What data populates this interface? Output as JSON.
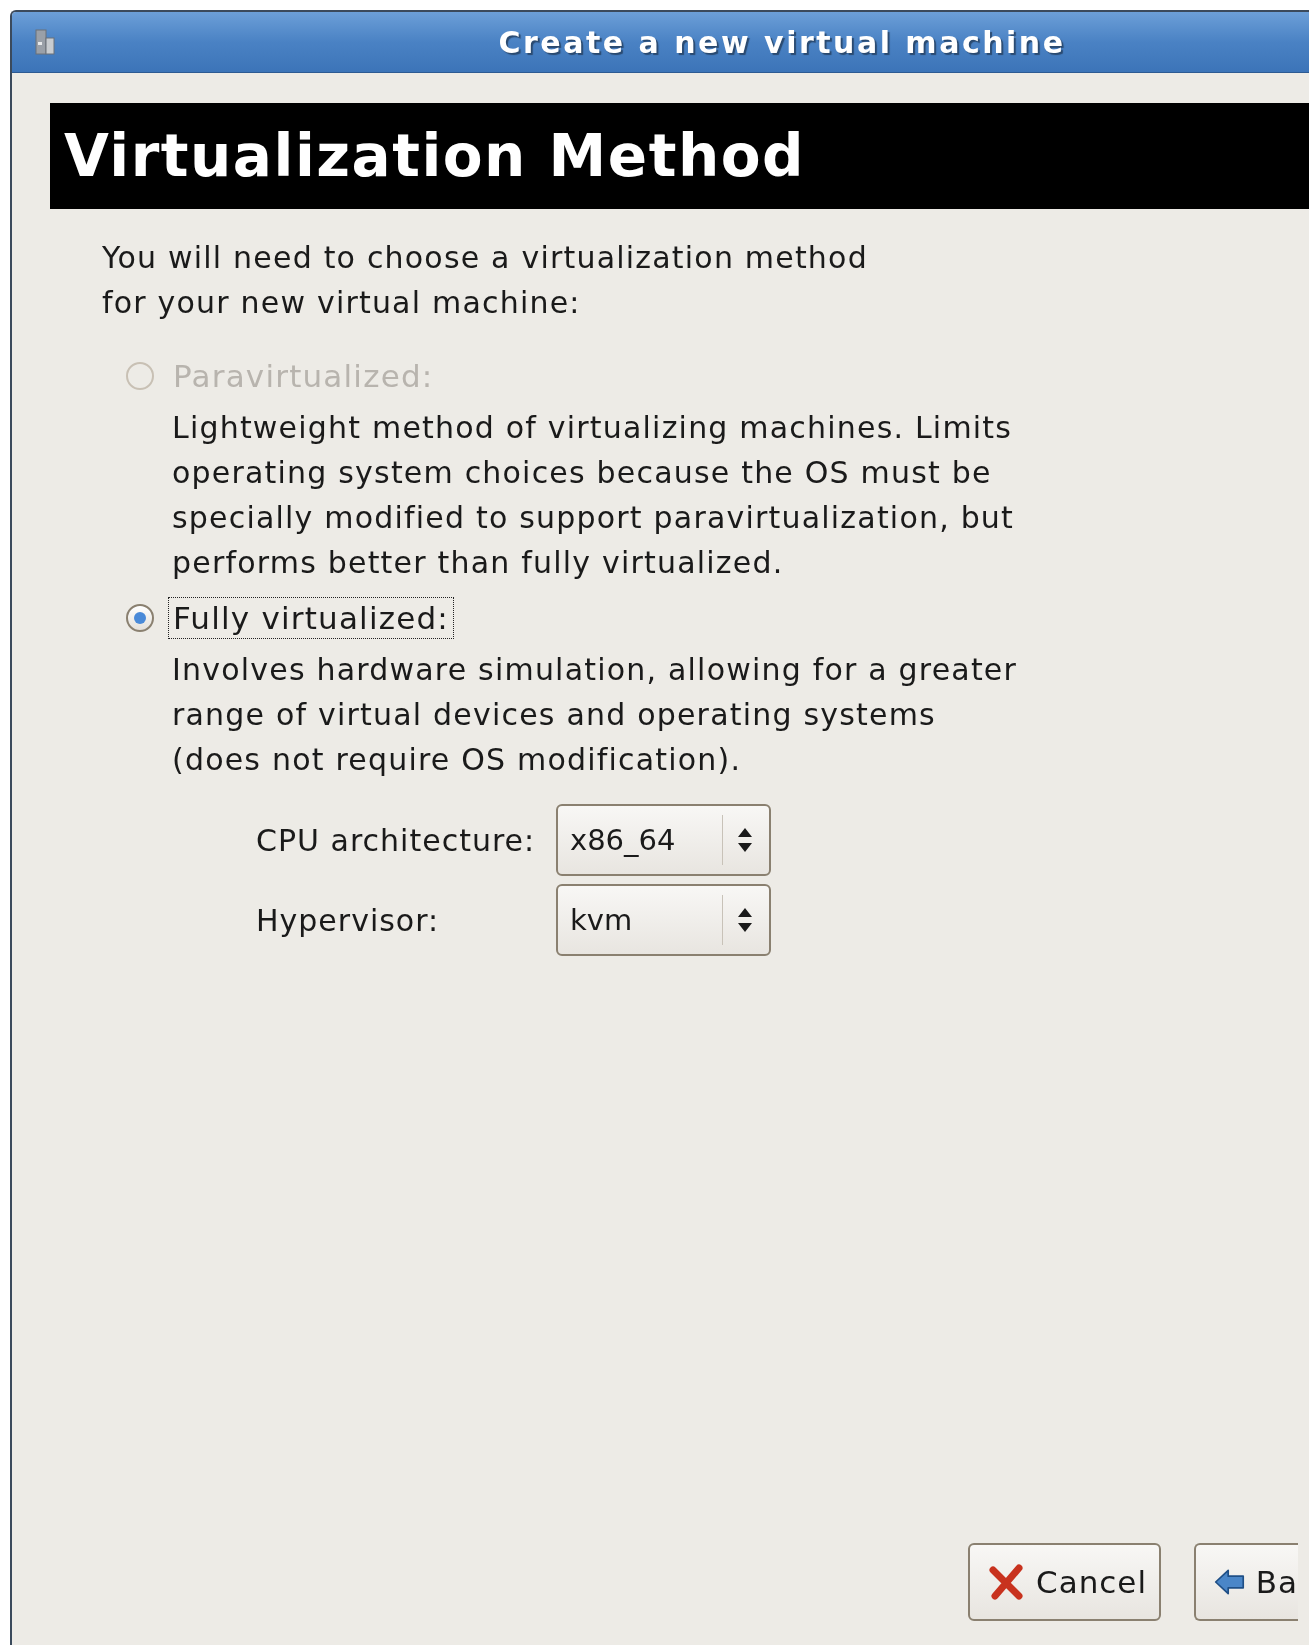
{
  "window": {
    "title": "Create a new virtual machine"
  },
  "heading": "Virtualization Method",
  "intro": "You will need to choose a virtualization method\nfor your new virtual machine:",
  "options": [
    {
      "label": "Paravirtualized:",
      "selected": false,
      "disabled": true,
      "focused": false,
      "description": "Lightweight method of virtualizing machines. Limits\noperating system choices because the OS must be\nspecially modified to support paravirtualization, but\nperforms better than fully virtualized."
    },
    {
      "label": "Fully virtualized:",
      "selected": true,
      "disabled": false,
      "focused": true,
      "description": "Involves hardware simulation, allowing for a greater\nrange of virtual devices and operating systems\n(does not require OS modification)."
    }
  ],
  "settings": [
    {
      "label": "CPU architecture:",
      "value": "x86_64"
    },
    {
      "label": "Hypervisor:",
      "value": "kvm"
    }
  ],
  "buttons": [
    {
      "kind": "cancel",
      "label": "Cancel"
    },
    {
      "kind": "back",
      "label": "Ba"
    }
  ]
}
